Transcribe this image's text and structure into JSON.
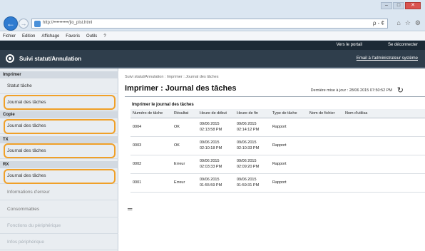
{
  "browser": {
    "url": "http://••••••••••/jlo_plst.html",
    "url_tools": "ρ - ¢",
    "menu": [
      "Fichier",
      "Edition",
      "Affichage",
      "Favoris",
      "Outils",
      "?"
    ],
    "window_buttons": [
      "–",
      "□",
      "✕"
    ],
    "chrome_icons": [
      "⌂",
      "☆",
      "⚙"
    ]
  },
  "header": {
    "portal_link": "Vers le portail",
    "logout_link": "Se déconnecter",
    "app_title": "Suivi statut/Annulation",
    "admin_link": "Email à l'administrateur système"
  },
  "sidebar": {
    "sections": [
      {
        "title": "Imprimer",
        "items": [
          "Statut tâche",
          "Journal des tâches"
        ]
      },
      {
        "title": "Copie",
        "items": [
          "Journal des tâches"
        ]
      },
      {
        "title": "TX",
        "items": [
          "Journal des tâches"
        ]
      },
      {
        "title": "RX",
        "items": [
          "Journal des tâches"
        ]
      }
    ],
    "extra_items": [
      "Informations d'erreur",
      "Consommables",
      "Fonctions du périphérique",
      "Infos périphérique"
    ]
  },
  "main": {
    "breadcrumb": "Suivi statut/Annulation : Imprimer : Journal des tâches",
    "title": "Imprimer : Journal des tâches",
    "update_label": "Dernière mise à jour :",
    "update_value": "28/06 2015 07:50:52 PM",
    "section_title": "Imprimer le journal des tâches",
    "columns": [
      "Numéro de tâche",
      "Résultat",
      "Heure de début",
      "Heure de fin",
      "Type de tâche",
      "Nom de fichier",
      "Nom d'utilisa"
    ],
    "rows": [
      {
        "job": "0004",
        "result": "OK",
        "start_date": "09/06 2015",
        "start_time": "02:13:58 PM",
        "end_date": "09/06 2015",
        "end_time": "02:14:12 PM",
        "type": "Rapport"
      },
      {
        "job": "0003",
        "result": "OK",
        "start_date": "09/06 2015",
        "start_time": "02:10:18 PM",
        "end_date": "09/06 2015",
        "end_time": "02:10:33 PM",
        "type": "Rapport"
      },
      {
        "job": "0002",
        "result": "Erreur",
        "start_date": "09/06 2015",
        "start_time": "02:03:33 PM",
        "end_date": "09/06 2015",
        "end_time": "02:09:20 PM",
        "type": "Rapport"
      },
      {
        "job": "0001",
        "result": "Erreur",
        "start_date": "09/06 2015",
        "start_time": "01:55:59 PM",
        "end_date": "09/06 2015",
        "end_time": "01:59:31 PM",
        "type": "Rapport"
      }
    ],
    "end_marker": "═"
  },
  "colors": {
    "highlight": "#f0a028",
    "header_bg": "#2f3e4c",
    "nav_blue": "#2f7bd0"
  }
}
